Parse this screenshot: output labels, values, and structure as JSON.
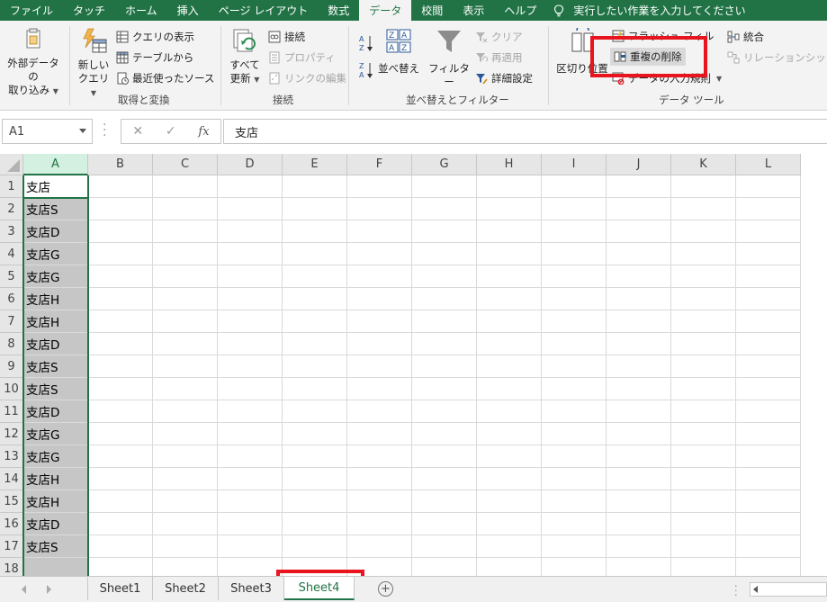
{
  "ribbon_tabs": [
    "ファイル",
    "タッチ",
    "ホーム",
    "挿入",
    "ページ レイアウト",
    "数式",
    "データ",
    "校閲",
    "表示",
    "ヘルプ"
  ],
  "active_tab_index": 6,
  "tell_me": "実行したい作業を入力してください",
  "groups": {
    "external": {
      "label1": "外部データの",
      "label2": "取り込み"
    },
    "get_transform": {
      "label": "取得と変換",
      "new_query_1": "新しい",
      "new_query_2": "クエリ",
      "show_queries": "クエリの表示",
      "from_table": "テーブルから",
      "recent_sources": "最近使ったソース"
    },
    "connections": {
      "label": "接続",
      "refresh_all_1": "すべて",
      "refresh_all_2": "更新",
      "connections": "接続",
      "properties": "プロパティ",
      "edit_links": "リンクの編集"
    },
    "sort_filter": {
      "label": "並べ替えとフィルター",
      "sort": "並べ替え",
      "filter": "フィルター",
      "clear": "クリア",
      "reapply": "再適用",
      "advanced": "詳細設定"
    },
    "data_tools": {
      "label": "データ ツール",
      "text_to_columns": "区切り位置",
      "flash_fill": "フラッシュ フィル",
      "remove_duplicates": "重複の削除",
      "data_validation": "データの入力規則",
      "consolidate": "統合",
      "relationships": "リレーションシップ"
    }
  },
  "formula_bar": {
    "name_box": "A1",
    "cancel": "✕",
    "enter": "✓",
    "fx": "fx",
    "content": "支店"
  },
  "columns": [
    "A",
    "B",
    "C",
    "D",
    "E",
    "F",
    "G",
    "H",
    "I",
    "J",
    "K",
    "L"
  ],
  "rows": [
    {
      "num": "1",
      "a": "支店"
    },
    {
      "num": "2",
      "a": "支店S"
    },
    {
      "num": "3",
      "a": "支店D"
    },
    {
      "num": "4",
      "a": "支店G"
    },
    {
      "num": "5",
      "a": "支店G"
    },
    {
      "num": "6",
      "a": "支店H"
    },
    {
      "num": "7",
      "a": "支店H"
    },
    {
      "num": "8",
      "a": "支店D"
    },
    {
      "num": "9",
      "a": "支店S"
    },
    {
      "num": "10",
      "a": "支店S"
    },
    {
      "num": "11",
      "a": "支店D"
    },
    {
      "num": "12",
      "a": "支店G"
    },
    {
      "num": "13",
      "a": "支店G"
    },
    {
      "num": "14",
      "a": "支店H"
    },
    {
      "num": "15",
      "a": "支店H"
    },
    {
      "num": "16",
      "a": "支店D"
    },
    {
      "num": "17",
      "a": "支店S"
    },
    {
      "num": "18",
      "a": ""
    }
  ],
  "sheets": [
    "Sheet1",
    "Sheet2",
    "Sheet3",
    "Sheet4"
  ],
  "active_sheet_index": 3,
  "add_sheet": "+",
  "colors": {
    "excel_green": "#217346",
    "highlight_red": "#e8141e",
    "selected_column_fill": "#c6c6c6"
  }
}
